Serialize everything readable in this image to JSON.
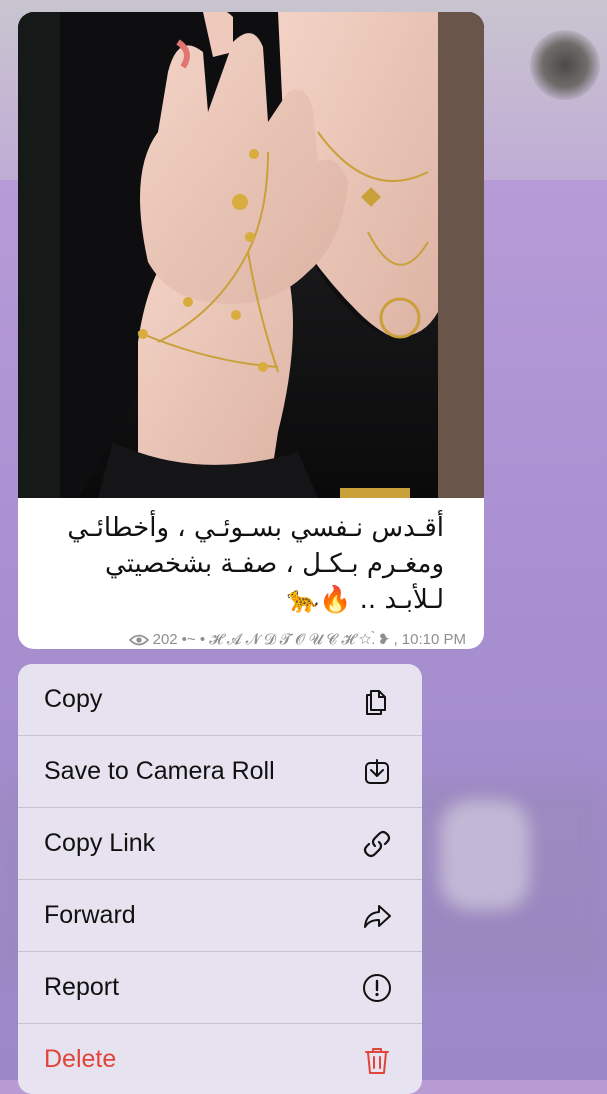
{
  "message": {
    "caption_lines": [
      "أقـدس نـفسي بسـوئـي ، وأخطائـي",
      "ومغـرم بـكـل ، صفـة بشخصيتي",
      "لـلأبـد .. 🔥🐆"
    ],
    "views": "202",
    "signature": "•~ • 𝓗 𝓐 𝓝 𝓓 𝓣 𝓞 𝓤 𝓒 𝓗 ☆.̀ ❥ ",
    "time": "10:10 PM"
  },
  "menu": {
    "items": [
      {
        "label": "Copy",
        "icon": "copy-icon"
      },
      {
        "label": "Save to Camera Roll",
        "icon": "download-icon"
      },
      {
        "label": "Copy Link",
        "icon": "link-icon"
      },
      {
        "label": "Forward",
        "icon": "forward-icon"
      },
      {
        "label": "Report",
        "icon": "exclamation-icon"
      },
      {
        "label": "Delete",
        "icon": "trash-icon",
        "color": "#e0453a"
      }
    ]
  },
  "colors": {
    "background": "#b89bd3",
    "danger": "#e0453a",
    "meta": "#8e8e93"
  }
}
